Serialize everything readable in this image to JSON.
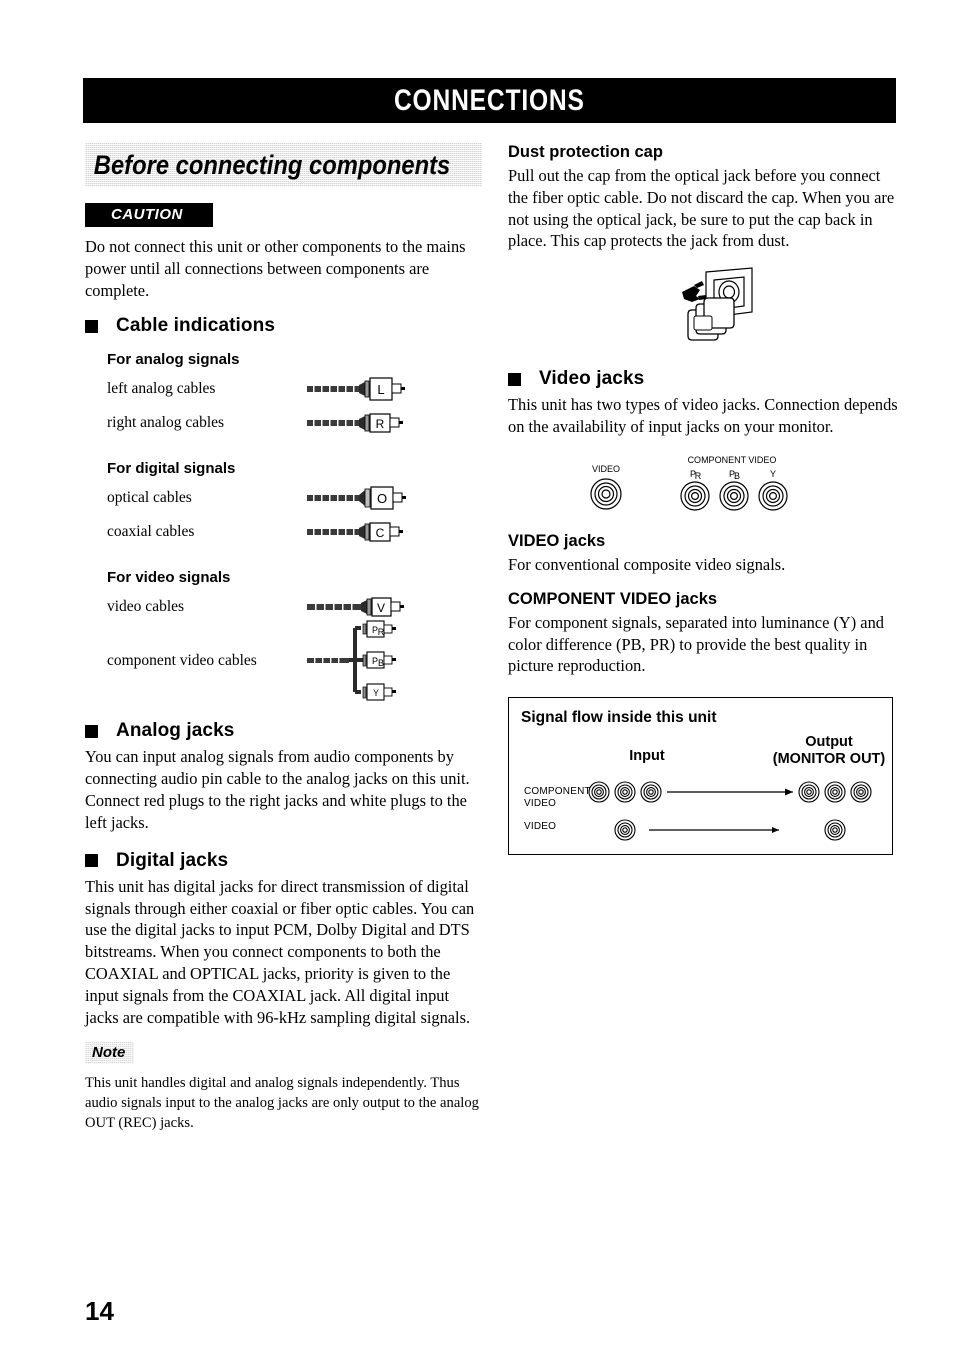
{
  "page": {
    "banner_title": "CONNECTIONS",
    "number": "14"
  },
  "left_column": {
    "section_title": "Before connecting components",
    "caution": {
      "badge": "CAUTION",
      "text": "Do not connect this unit or other components to the mains power until all connections between components are complete."
    },
    "cable_indications": {
      "heading": "Cable indications",
      "groups": [
        {
          "title": "For analog signals",
          "rows": [
            {
              "label": "left analog cables",
              "connector": "L",
              "type": "single"
            },
            {
              "label": "right analog cables",
              "connector": "R",
              "type": "single"
            }
          ]
        },
        {
          "title": "For digital signals",
          "rows": [
            {
              "label": "optical cables",
              "connector": "O",
              "type": "single"
            },
            {
              "label": "coaxial cables",
              "connector": "C",
              "type": "single"
            }
          ]
        },
        {
          "title": "For video signals",
          "rows": [
            {
              "label": "video cables",
              "connector": "V",
              "type": "single"
            },
            {
              "label": "component video cables",
              "connectors": [
                "PR",
                "PB",
                "Y"
              ],
              "type": "triple"
            }
          ]
        }
      ]
    },
    "analog_jacks": {
      "heading": "Analog jacks",
      "text": "You can input analog signals from audio components by connecting audio pin cable to the analog jacks on this unit. Connect red plugs to the right jacks and white plugs to the left jacks."
    },
    "digital_jacks": {
      "heading": "Digital jacks",
      "text": "This unit has digital jacks for direct transmission of digital signals through either coaxial or fiber optic cables. You can use the digital jacks to input PCM, Dolby Digital and DTS bitstreams. When you connect components to both the COAXIAL and OPTICAL jacks, priority is given to the input signals from the COAXIAL jack. All digital input jacks are compatible with 96-kHz sampling digital signals."
    },
    "note": {
      "badge": "Note",
      "text": "This unit handles digital and analog signals independently. Thus audio signals input to the analog jacks are only output to the analog OUT (REC) jacks."
    }
  },
  "right_column": {
    "dust_cap": {
      "heading": "Dust protection cap",
      "text": "Pull out the cap from the optical jack before you connect the fiber optic cable. Do not discard the cap. When you are not using the optical jack, be sure to put the cap back in place. This cap protects the jack from dust."
    },
    "video_jacks": {
      "heading": "Video jacks",
      "text": "This unit has two types of video jacks. Connection depends on the availability of input jacks on your monitor."
    },
    "jack_diagram": {
      "video_label": "VIDEO",
      "component_label": "COMPONENT VIDEO",
      "component_jacks": [
        "PR",
        "PB",
        "Y"
      ]
    },
    "video_jacks_detail": {
      "heading": "VIDEO jacks",
      "text": "For conventional composite video signals."
    },
    "component_video_detail": {
      "heading": "COMPONENT VIDEO jacks",
      "text": "For component signals, separated into luminance (Y) and color difference (PB, PR) to provide the best quality in picture reproduction."
    },
    "signal_flow": {
      "title": "Signal flow inside this unit",
      "input_label": "Input",
      "output_label_line1": "Output",
      "output_label_line2": "(MONITOR OUT)",
      "row1_label_line1": "COMPONENT",
      "row1_label_line2": "VIDEO",
      "row2_label": "VIDEO"
    }
  }
}
